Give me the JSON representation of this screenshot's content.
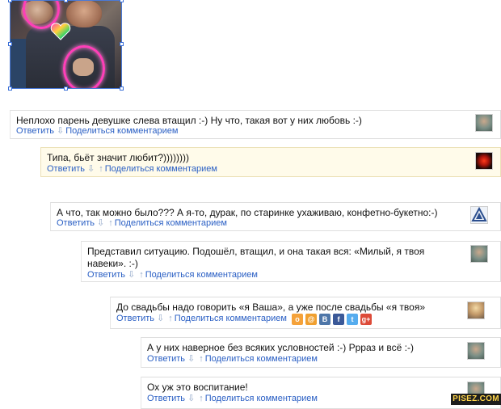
{
  "photo": {
    "icon": "photo-thumbnail-image"
  },
  "comments": [
    {
      "text": "Неплохо парень девушке слева втащил :-) Ну что, такая вот у них любовь :-)",
      "reply": "Ответить",
      "share": "Поделиться комментарием",
      "up_arrow": false
    },
    {
      "text": "Типа, бьёт значит любит?))))))))",
      "reply": "Ответить",
      "share": "Поделиться комментарием",
      "up_arrow": true
    },
    {
      "text": "А что, так можно было??? А я-то, дурак, по старинке ухаживаю, конфетно-букетно:-)",
      "reply": "Ответить",
      "share": "Поделиться комментарием",
      "up_arrow": true
    },
    {
      "text_line1": "Представил ситуацию. Подошёл, втащил, и она такая вся: «Милый, я твоя",
      "text_line2": "навеки». :-)",
      "reply": "Ответить",
      "share": "Поделиться комментарием",
      "up_arrow": true
    },
    {
      "text": "До свадьбы надо говорить «я Ваша», а уже после свадьбы «я твоя»",
      "reply": "Ответить",
      "share": "Поделиться комментарием",
      "up_arrow": true
    },
    {
      "text": "А у них наверное без всяких условностей :-) Ррраз и всё :-)",
      "reply": "Ответить",
      "share": "Поделиться комментарием",
      "up_arrow": true
    },
    {
      "text": "Ох уж это воспитание!",
      "reply": "Ответить",
      "share": "Поделиться комментарием",
      "up_arrow": true
    }
  ],
  "arrows": {
    "down": "⇩",
    "up": "↑"
  },
  "share_networks": [
    {
      "name": "odnoklassniki-icon",
      "glyph": "о",
      "color": "#f5a23a"
    },
    {
      "name": "mailru-icon",
      "glyph": "@",
      "color": "#f0a030"
    },
    {
      "name": "vkontakte-icon",
      "glyph": "В",
      "color": "#4e76a8"
    },
    {
      "name": "facebook-icon",
      "glyph": "f",
      "color": "#3b5998"
    },
    {
      "name": "twitter-icon",
      "glyph": "t",
      "color": "#55acee"
    },
    {
      "name": "googleplus-icon",
      "glyph": "g+",
      "color": "#dd4b39"
    }
  ],
  "watermark": "PISEZ.COM"
}
